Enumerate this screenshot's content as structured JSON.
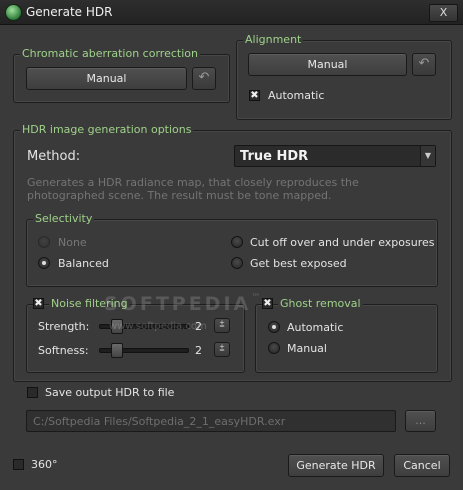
{
  "window": {
    "title": "Generate HDR",
    "close_label": "X"
  },
  "chromatic": {
    "title": "Chromatic aberration correction",
    "button": "Manual"
  },
  "alignment": {
    "title": "Alignment",
    "button": "Manual",
    "automatic_label": "Automatic",
    "automatic_checked": true
  },
  "hdr": {
    "title": "HDR image generation options",
    "method_label": "Method:",
    "method_value": "True HDR",
    "description": "Generates a HDR radiance map, that closely reproduces the photographed scene. The result must be tone mapped."
  },
  "selectivity": {
    "title": "Selectivity",
    "options": [
      "None",
      "Balanced",
      "Cut off over and under exposures",
      "Get best exposed"
    ],
    "selected": "Balanced"
  },
  "noise": {
    "title": "Noise filtering",
    "checked": true,
    "strength_label": "Strength:",
    "strength_value": "2",
    "softness_label": "Softness:",
    "softness_value": "2"
  },
  "ghost": {
    "title": "Ghost removal",
    "checked": true,
    "options": [
      "Automatic",
      "Manual"
    ],
    "selected": "Automatic"
  },
  "save": {
    "label": "Save output HDR to file",
    "checked": false,
    "path": "C:/Softpedia Files/Softpedia_2_1_easyHDR.exr",
    "browse_label": "..."
  },
  "footer": {
    "degree_label": "360°",
    "generate_label": "Generate HDR",
    "cancel_label": "Cancel"
  },
  "watermark": {
    "text": "SOFTPEDIA",
    "tm": "™",
    "url": "www.softpedia.com"
  }
}
